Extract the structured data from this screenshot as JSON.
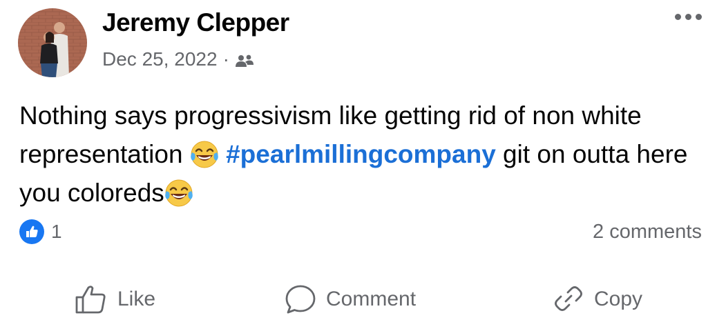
{
  "post": {
    "author": "Jeremy Clepper",
    "date": "Dec 25, 2022",
    "separator": "·",
    "audience_icon": "friends-icon",
    "text_part1": "Nothing says progressivism like getting rid of non white representation ",
    "hashtag": "#pearlmillingcompany",
    "text_part2": " git on outta here you coloreds",
    "emoji": "face-with-tears-of-joy"
  },
  "reactions": {
    "count": "1",
    "comments": "2 comments"
  },
  "actions": {
    "like": "Like",
    "comment": "Comment",
    "copy": "Copy"
  },
  "colors": {
    "accent": "#1877f2",
    "hashtag": "#1b6fd6",
    "muted_text": "#65676b"
  }
}
